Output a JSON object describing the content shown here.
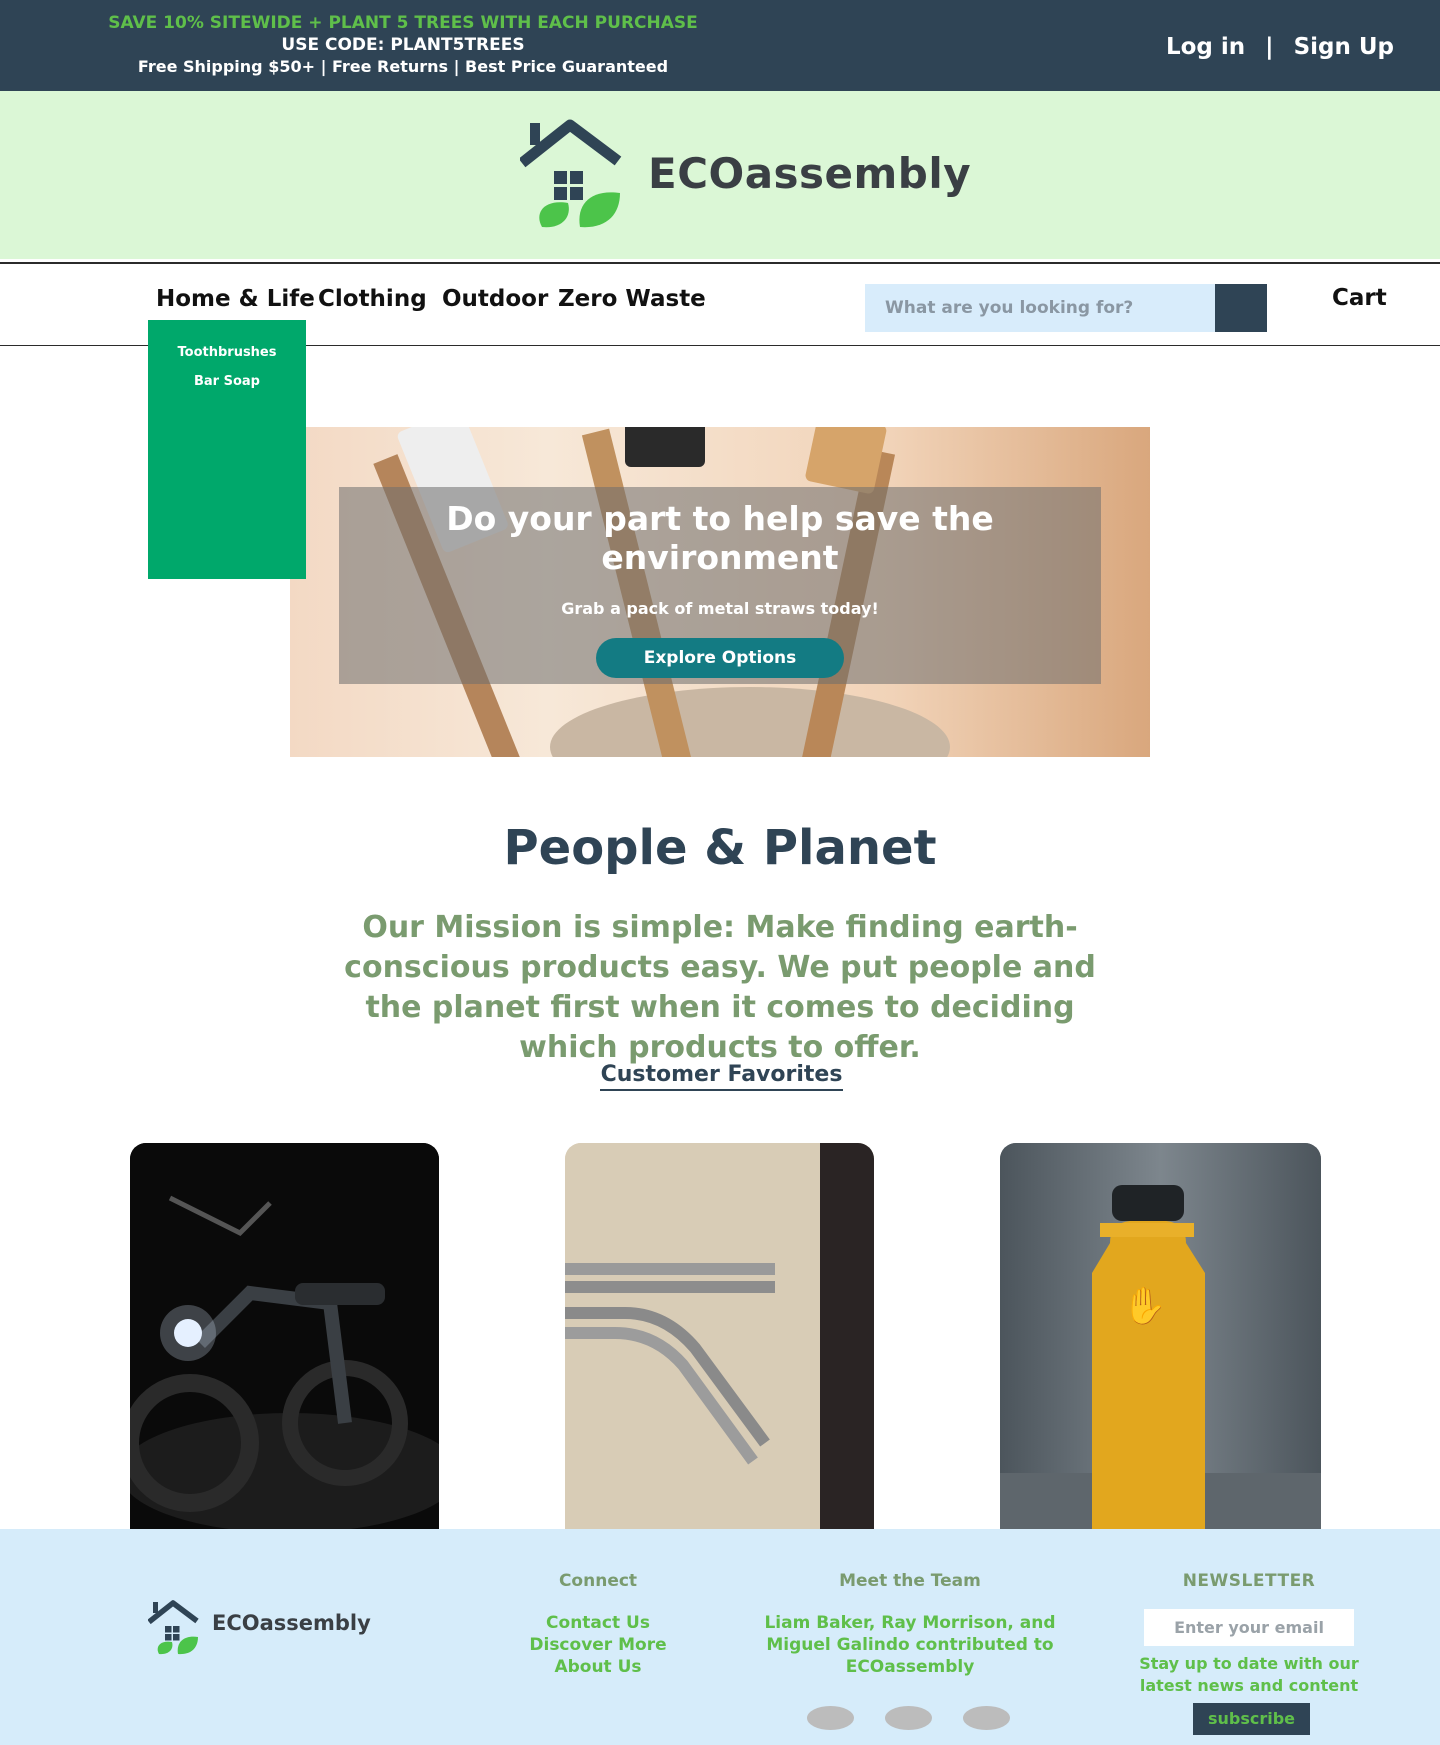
{
  "promo": {
    "line1": "SAVE 10% SITEWIDE + PLANT 5 TREES WITH EACH PURCHASE",
    "line2": "USE CODE: PLANT5TREES",
    "line3": "Free Shipping $50+ | Free Returns | Best Price Guaranteed"
  },
  "auth": {
    "login": "Log in",
    "separator": "|",
    "signup": "Sign Up"
  },
  "brand": {
    "name": "ECOassembly"
  },
  "nav": {
    "items": [
      "Home & Life",
      "Clothing",
      "Outdoor",
      "Zero Waste"
    ],
    "search_placeholder": "What are you looking for?",
    "cart": "Cart"
  },
  "dropdown": {
    "items": [
      "Toothbrushes",
      "Bar Soap"
    ]
  },
  "hero": {
    "title": "Do your part to help save the environment",
    "subtitle": "Grab a pack of metal straws today!",
    "button": "Explore Options"
  },
  "mission": {
    "heading": "People & Planet",
    "text": "Our Mission is simple: Make finding earth-conscious products easy. We put people and the planet first when it comes to deciding which products to offer.",
    "favorites_link": "Customer Favorites"
  },
  "footer": {
    "connect_heading": "Connect",
    "connect_links": [
      "Contact Us",
      "Discover More",
      "About Us"
    ],
    "team_heading": "Meet the Team",
    "team_text": "Liam Baker, Ray Morrison, and Miguel Galindo contributed to ECOassembly",
    "newsletter_heading": "NEWSLETTER",
    "email_placeholder": "Enter your email",
    "newsletter_text": "Stay up to date with our latest news and content",
    "subscribe": "subscribe"
  },
  "colors": {
    "navy": "#2f4455",
    "promo_green": "#5fbf4a",
    "mint": "#dbf7d6",
    "dropdown_green": "#00a86b",
    "teal_button": "#137b83",
    "sage": "#7a9b6f",
    "footer_blue": "#d6ecfa"
  }
}
